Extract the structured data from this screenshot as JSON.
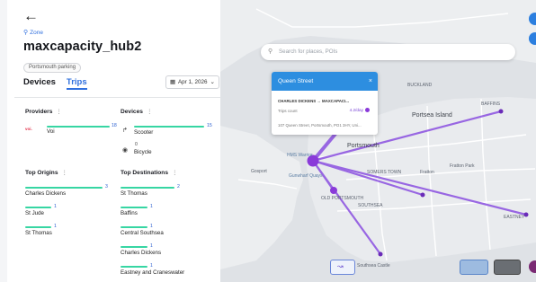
{
  "header": {
    "back_icon": "arrow-left-icon",
    "zone_label": "Zone",
    "title": "maxcapacity_hub2",
    "tag": "Portsmouth parking",
    "tabs": [
      {
        "label": "Devices"
      },
      {
        "label": "Trips"
      }
    ],
    "active_tab": "Trips",
    "date": "Apr 1, 2026"
  },
  "providers": {
    "heading": "Providers",
    "items": [
      {
        "name": "Voi",
        "value": "18"
      }
    ]
  },
  "devices": {
    "heading": "Devices",
    "items": [
      {
        "name": "Scooter",
        "value": "15",
        "icon": "scooter-icon"
      },
      {
        "name": "Bicycle",
        "value": "0",
        "icon": "bicycle-icon"
      }
    ]
  },
  "top_origins": {
    "heading": "Top Origins",
    "items": [
      {
        "name": "Charles Dickens",
        "value": "3"
      },
      {
        "name": "St Jude",
        "value": "1"
      },
      {
        "name": "St Thomas",
        "value": "1"
      }
    ]
  },
  "top_destinations": {
    "heading": "Top Destinations",
    "items": [
      {
        "name": "St Thomas",
        "value": "2"
      },
      {
        "name": "Baffins",
        "value": "1"
      },
      {
        "name": "Central Southsea",
        "value": "1"
      },
      {
        "name": "Charles Dickens",
        "value": "1"
      },
      {
        "name": "Eastney and Craneswater",
        "value": "1"
      }
    ]
  },
  "map": {
    "search_placeholder": "Search for places, POIs",
    "popup": {
      "title": "Queen Street",
      "route": "CHARLES DICKENS → MAXCAPACI...",
      "trips_label": "Trips count",
      "count": "4.2/day",
      "address": "107 Queen Street, Portsmouth, PO1 3HY, Uni..."
    },
    "labels": [
      {
        "text": "Portsea Island",
        "big": true
      },
      {
        "text": "Portsmouth",
        "big": true
      },
      {
        "text": "BUCKLAND"
      },
      {
        "text": "BAFFINS"
      },
      {
        "text": "Gosport"
      },
      {
        "text": "SOMERS TOWN"
      },
      {
        "text": "SOUTHSEA"
      },
      {
        "text": "OLD PORTSMOUTH"
      },
      {
        "text": "EASTNEY"
      },
      {
        "text": "Fratton"
      },
      {
        "text": "Fratton Park"
      },
      {
        "text": "HMS Warrior"
      },
      {
        "text": "Gunwharf Quays"
      },
      {
        "text": "Southsea Castle"
      }
    ]
  }
}
